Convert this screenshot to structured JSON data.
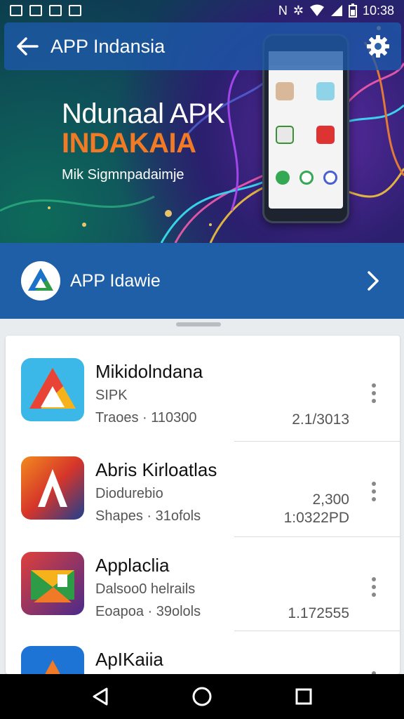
{
  "status_bar": {
    "time": "10:38"
  },
  "app_bar": {
    "title": "APP Indansia",
    "back_icon": "arrow-left-icon",
    "settings_icon": "gear-icon"
  },
  "hero": {
    "title_line1": "Ndunaal APK",
    "title_line2": "INDAKAIA",
    "subtitle": "Mik Sigmnpadaimje",
    "accent_color": "#f07a25"
  },
  "promo": {
    "label": "APP Idawie",
    "chevron_icon": "chevron-right-icon",
    "bar_color": "#1f5fa8"
  },
  "apps": [
    {
      "name": "Mikidolndana",
      "line1": "SIPK",
      "line2": "Traoes · 110300",
      "value1": "",
      "value2": "2.1/3013"
    },
    {
      "name": "Abris Kirloatlas",
      "line1": "Diodurebio",
      "line2": "Shapes · 31ofols",
      "value1": "2,300",
      "value2": "1:0322PD"
    },
    {
      "name": "Applaclia",
      "line1": "Dalsoo0 helrails",
      "line2": "Eoapoa · 39olols",
      "value1": "",
      "value2": "1.172555"
    },
    {
      "name": "ApIKaiia",
      "line1": "",
      "line2": "",
      "value1": "",
      "value2": ""
    }
  ],
  "nav": {
    "back": "nav-back-icon",
    "home": "nav-home-icon",
    "recents": "nav-recents-icon"
  }
}
